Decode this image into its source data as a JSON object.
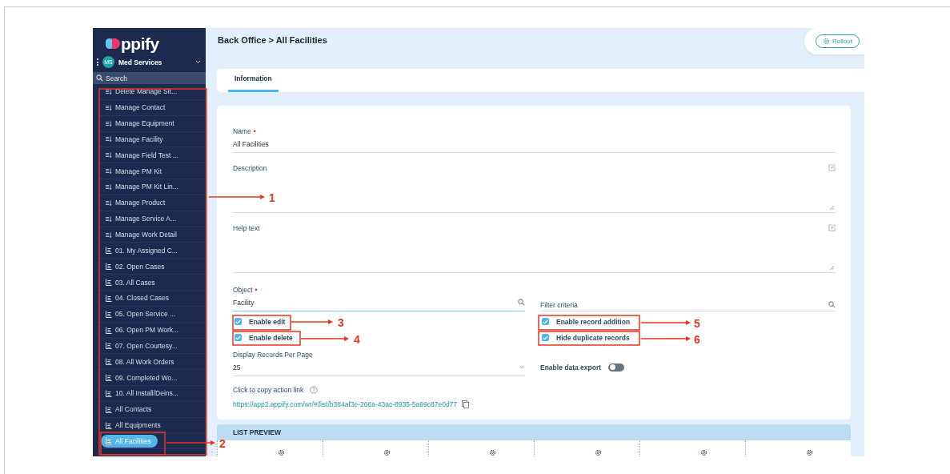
{
  "sidebar": {
    "logo": "ppify",
    "workspace": {
      "avatar": "MS",
      "name": "Med Services"
    },
    "search": {
      "placeholder": "Search"
    },
    "items": [
      {
        "label": "Delete Manage Sit...",
        "kind": "action",
        "selected": false
      },
      {
        "label": "Manage Contact",
        "kind": "action",
        "selected": false
      },
      {
        "label": "Manage Equipment",
        "kind": "action",
        "selected": false
      },
      {
        "label": "Manage Facility",
        "kind": "action",
        "selected": false
      },
      {
        "label": "Manage Field Test ...",
        "kind": "action",
        "selected": false
      },
      {
        "label": "Manage PM Kit",
        "kind": "action",
        "selected": false
      },
      {
        "label": "Manage PM Kit Lin...",
        "kind": "action",
        "selected": false
      },
      {
        "label": "Manage Product",
        "kind": "action",
        "selected": false
      },
      {
        "label": "Manage Service A...",
        "kind": "action",
        "selected": false
      },
      {
        "label": "Manage Work Detail",
        "kind": "action",
        "selected": false
      },
      {
        "label": "01. My Assigned C...",
        "kind": "report",
        "selected": false
      },
      {
        "label": "02. Open Cases",
        "kind": "report",
        "selected": false
      },
      {
        "label": "03. All Cases",
        "kind": "report",
        "selected": false
      },
      {
        "label": "04. Closed Cases",
        "kind": "report",
        "selected": false
      },
      {
        "label": "05. Open Service ...",
        "kind": "report",
        "selected": false
      },
      {
        "label": "06. Open PM Work...",
        "kind": "report",
        "selected": false
      },
      {
        "label": "07. Open Courtesy...",
        "kind": "report",
        "selected": false
      },
      {
        "label": "08. All Work Orders",
        "kind": "report",
        "selected": false
      },
      {
        "label": "09. Completed Wo...",
        "kind": "report",
        "selected": false
      },
      {
        "label": "10. All Install/Deins...",
        "kind": "report",
        "selected": false
      },
      {
        "label": "All Contacts",
        "kind": "report",
        "selected": false
      },
      {
        "label": "All Equipments",
        "kind": "report",
        "selected": false
      },
      {
        "label": "All Facilities",
        "kind": "report",
        "selected": true
      }
    ]
  },
  "header": {
    "breadcrumb": "Back Office > All Facilities",
    "button": "Rollout"
  },
  "tabs": [
    {
      "label": "Information",
      "selected": true
    }
  ],
  "form": {
    "name": {
      "label": "Name",
      "required_mark": "•",
      "value": "All Facilities"
    },
    "description": {
      "label": "Description"
    },
    "help_text": {
      "label": "Help text"
    },
    "object": {
      "label": "Object",
      "required_mark": "•",
      "value": "Facility"
    },
    "filter": {
      "placeholder": "Filter criteria"
    },
    "checkboxes": [
      {
        "label": "Enable edit",
        "checked": true
      },
      {
        "label": "Enable record addition",
        "checked": true
      },
      {
        "label": "Enable delete",
        "checked": true
      },
      {
        "label": "Hide duplicate records",
        "checked": true
      }
    ],
    "records_per_page": {
      "label": "Display Records Per Page",
      "value": "25"
    },
    "data_export": {
      "label": "Enable data export",
      "on": false
    },
    "action_link": {
      "label": "Click to copy action link",
      "url": "https://app2.appify.com/wr/#/list/b384af3e-266a-43ac-8935-5a99c87e0d77"
    }
  },
  "list_preview": {
    "title": "LIST PREVIEW"
  },
  "callouts": [
    {
      "label": "1"
    },
    {
      "label": "2"
    },
    {
      "label": "3"
    },
    {
      "label": "4"
    },
    {
      "label": "5"
    },
    {
      "label": "6"
    }
  ]
}
